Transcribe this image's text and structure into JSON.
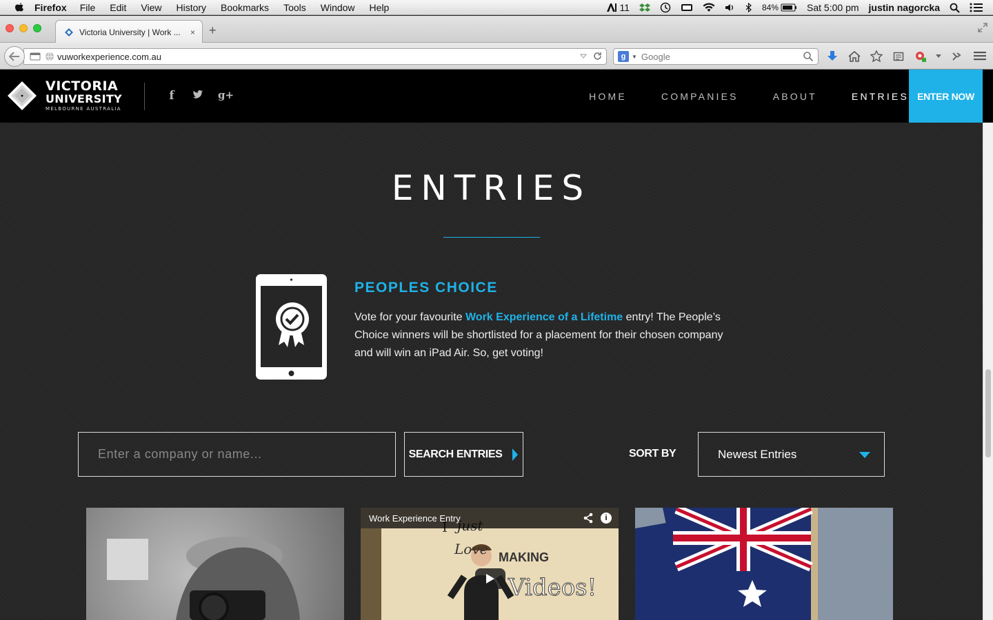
{
  "menubar": {
    "app_name": "Firefox",
    "items": [
      "File",
      "Edit",
      "View",
      "History",
      "Bookmarks",
      "Tools",
      "Window",
      "Help"
    ],
    "adobe_count": "11",
    "battery": "84%",
    "clock": "Sat 5:00 pm",
    "user": "justin nagorcka"
  },
  "browser": {
    "tab_title": "Victoria University | Work ...",
    "tab_close": "×",
    "new_tab": "+",
    "url": "vuworkexperience.com.au",
    "search_engine_label": "g",
    "search_placeholder": "Google"
  },
  "site": {
    "logo": {
      "line1": "VICTORIA",
      "line2": "UNIVERSITY",
      "line3": "MELBOURNE AUSTRALIA"
    },
    "social": [
      "f",
      "t",
      "g+"
    ],
    "nav": [
      "HOME",
      "COMPANIES",
      "ABOUT",
      "ENTRIES"
    ],
    "active_nav": "ENTRIES",
    "cta": "ENTER NOW",
    "accent": "#1fb2e8"
  },
  "page": {
    "title": "ENTRIES",
    "peoples_choice": {
      "heading": "PEOPLES CHOICE",
      "text_before": "Vote for your favourite ",
      "highlight": "Work Experience of a Lifetime",
      "text_after": " entry! The People’s Choice winners will be shortlisted for a placement for their chosen company and will win an iPad Air. So, get voting!"
    },
    "search": {
      "placeholder": "Enter a company or name...",
      "button": "SEARCH ENTRIES"
    },
    "sort": {
      "label": "SORT BY",
      "selected": "Newest Entries"
    },
    "entries": [
      {
        "type": "photo"
      },
      {
        "type": "video",
        "video_title": "Work Experience Entry",
        "words": [
          "I",
          "just",
          "Love",
          "MAKING",
          "Videos!"
        ]
      },
      {
        "type": "photo"
      }
    ]
  }
}
